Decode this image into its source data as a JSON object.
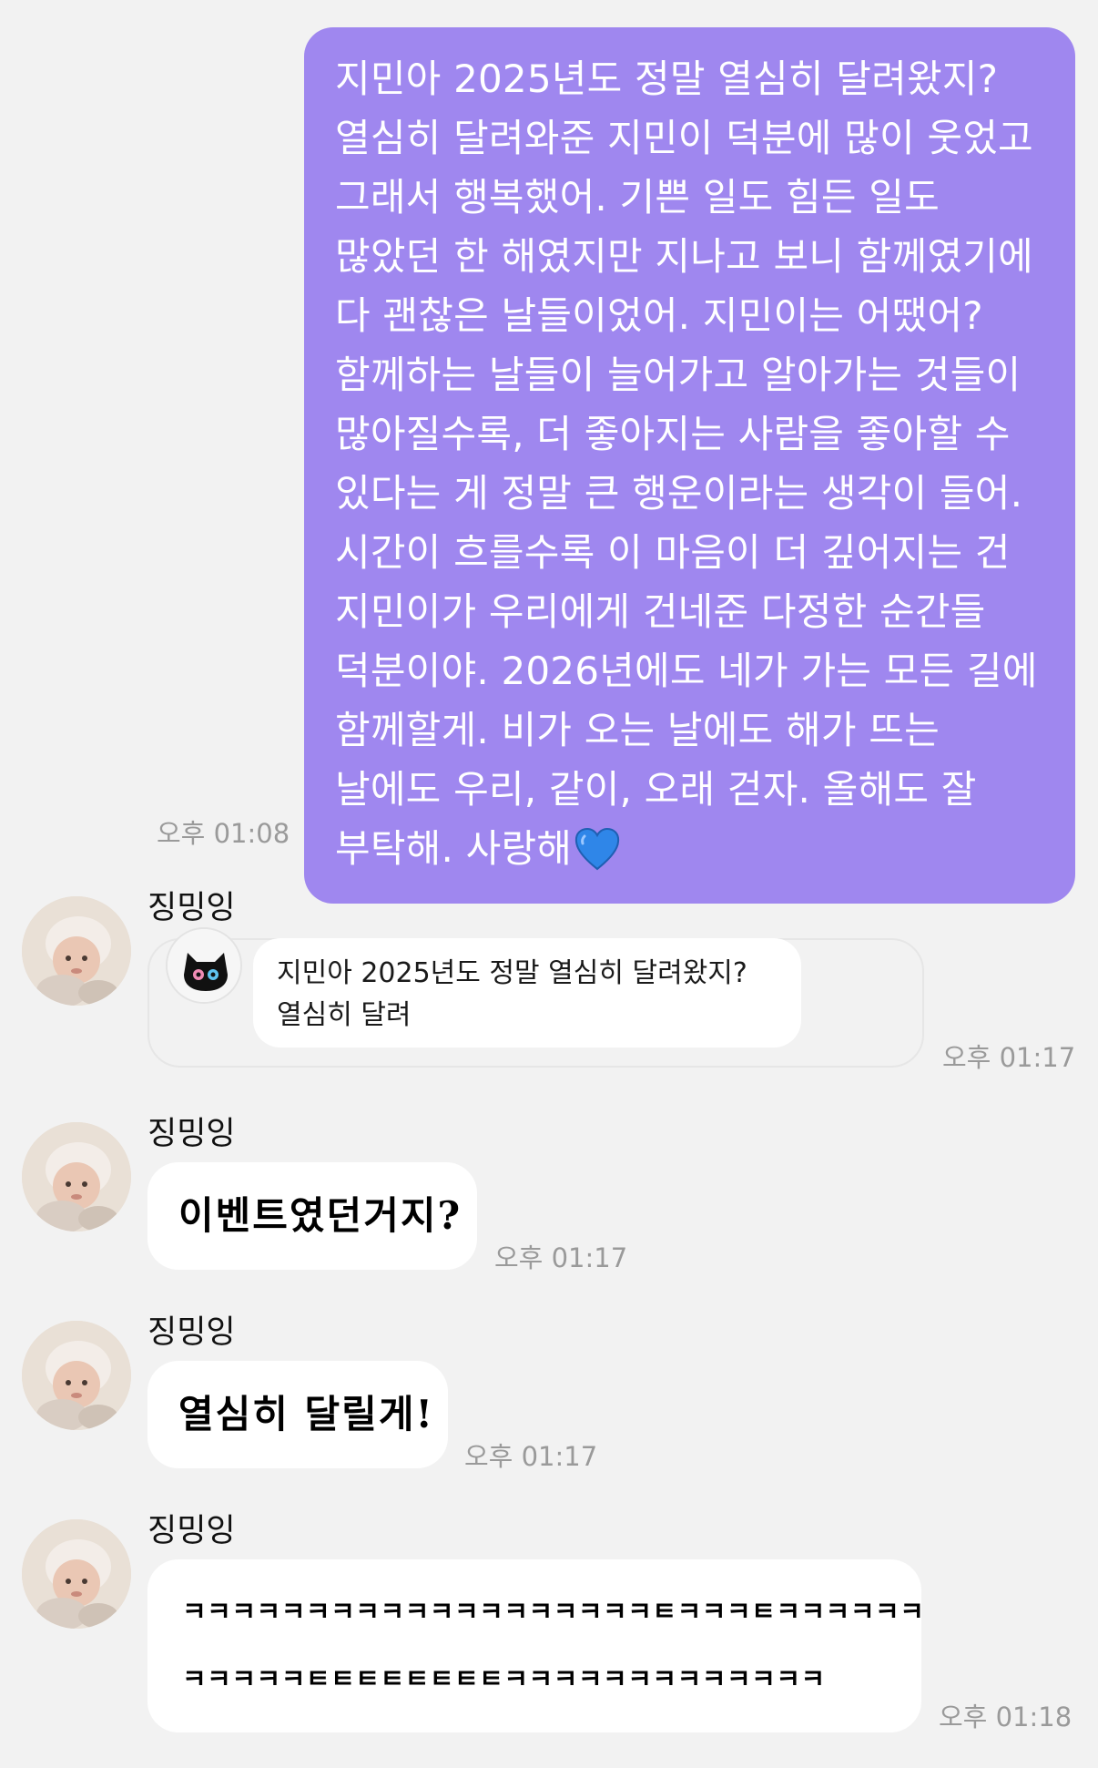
{
  "outgoing": {
    "text": "지민아 2025년도 정말 열심히 달려왔지? 열심히 달려와준 지민이 덕분에 많이 웃었고 그래서 행복했어. 기쁜 일도 힘든 일도 많았던 한 해였지만 지나고 보니 함께였기에 다 괜찮은 날들이었어. 지민이는 어땠어? 함께하는 날들이 늘어가고 알아가는 것들이 많아질수록, 더 좋아지는 사람을 좋아할 수 있다는 게 정말 큰 행운이라는 생각이 들어. 시간이 흐를수록 이 마음이 더 깊어지는 건 지민이가 우리에게 건네준 다정한 순간들 덕분이야. 2026년에도 네가 가는 모든 길에 함께할게. 비가 오는 날에도 해가 뜨는 날에도 우리, 같이, 오래 걷자. 올해도 잘 부탁해. 사랑해",
    "emoji": "blue-heart-icon",
    "time": "오후 01:08"
  },
  "messages": [
    {
      "sender": "징밍잉",
      "type": "reply",
      "quote": "지민아 2025년도 정말 열심히 달려왔지? 열심히 달려",
      "time": "오후 01:17"
    },
    {
      "sender": "징밍잉",
      "type": "text",
      "text": "이벤트였던거지?",
      "time": "오후 01:17"
    },
    {
      "sender": "징밍잉",
      "type": "text",
      "text": "열심히 달릴게!",
      "time": "오후 01:17"
    },
    {
      "sender": "징밍잉",
      "type": "text",
      "lines": [
        "ㅋㅋㅋㅋㅋㅋㅋㅋㅋㅋㅋㅋㅋㅋㅋㅋㅋㅋㅋㅌㅋㅋㅋㅌㅋㅋㅋㅋㅋㅋㅋㅋ",
        "ㅋㅋㅋㅋㅋㅌㅌㅌㅌㅌㅌㅌㅌㅋㅋㅋㅋㅋㅋㅋㅋㅋㅋㅋㅋㅋ"
      ],
      "time": "오후 01:18"
    }
  ],
  "colors": {
    "background": "#f2f2f2",
    "outgoing_bubble": "#9f87ef",
    "incoming_bubble": "#ffffff",
    "timestamp": "#9a9a9a",
    "heart": "#2f86e8"
  }
}
